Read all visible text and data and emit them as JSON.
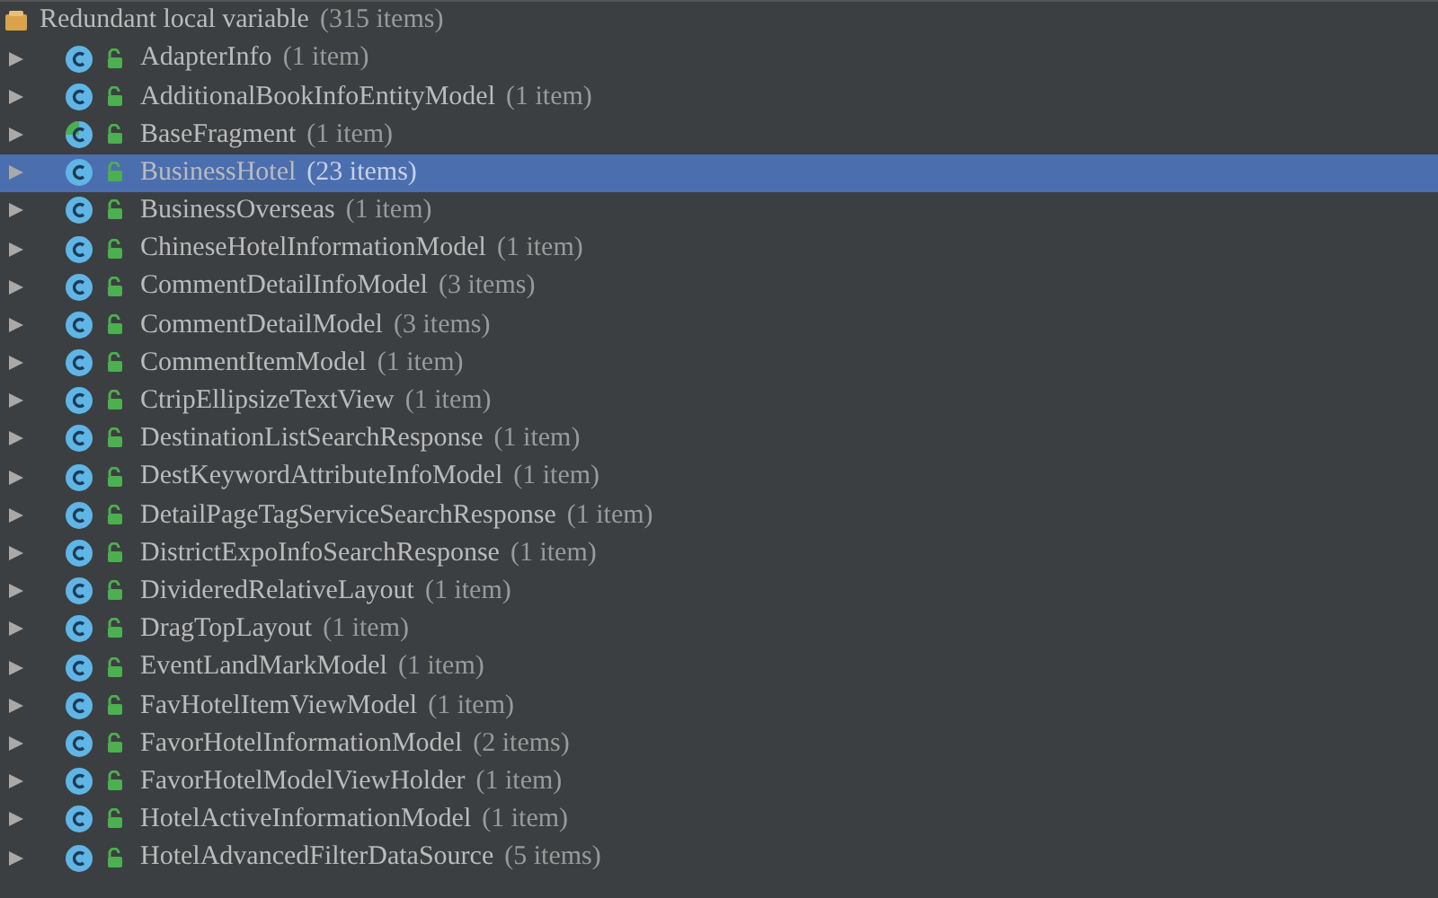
{
  "group": {
    "name": "Redundant local variable",
    "count": "(315 items)"
  },
  "items": [
    {
      "name": "AdapterInfo",
      "count": "(1 item)",
      "kind": "class",
      "selected": false
    },
    {
      "name": "AdditionalBookInfoEntityModel",
      "count": "(1 item)",
      "kind": "class",
      "selected": false
    },
    {
      "name": "BaseFragment",
      "count": "(1 item)",
      "kind": "abstract",
      "selected": false
    },
    {
      "name": "BusinessHotel",
      "count": "(23 items)",
      "kind": "class",
      "selected": true
    },
    {
      "name": "BusinessOverseas",
      "count": "(1 item)",
      "kind": "class",
      "selected": false
    },
    {
      "name": "ChineseHotelInformationModel",
      "count": "(1 item)",
      "kind": "class",
      "selected": false
    },
    {
      "name": "CommentDetailInfoModel",
      "count": "(3 items)",
      "kind": "class",
      "selected": false
    },
    {
      "name": "CommentDetailModel",
      "count": "(3 items)",
      "kind": "class",
      "selected": false
    },
    {
      "name": "CommentItemModel",
      "count": "(1 item)",
      "kind": "class",
      "selected": false
    },
    {
      "name": "CtripEllipsizeTextView",
      "count": "(1 item)",
      "kind": "class",
      "selected": false
    },
    {
      "name": "DestinationListSearchResponse",
      "count": "(1 item)",
      "kind": "class",
      "selected": false
    },
    {
      "name": "DestKeywordAttributeInfoModel",
      "count": "(1 item)",
      "kind": "class",
      "selected": false
    },
    {
      "name": "DetailPageTagServiceSearchResponse",
      "count": "(1 item)",
      "kind": "class",
      "selected": false
    },
    {
      "name": "DistrictExpoInfoSearchResponse",
      "count": "(1 item)",
      "kind": "class",
      "selected": false
    },
    {
      "name": "DivideredRelativeLayout",
      "count": "(1 item)",
      "kind": "class",
      "selected": false
    },
    {
      "name": "DragTopLayout",
      "count": "(1 item)",
      "kind": "class",
      "selected": false
    },
    {
      "name": "EventLandMarkModel",
      "count": "(1 item)",
      "kind": "class",
      "selected": false
    },
    {
      "name": "FavHotelItemViewModel",
      "count": "(1 item)",
      "kind": "class",
      "selected": false
    },
    {
      "name": "FavorHotelInformationModel",
      "count": "(2 items)",
      "kind": "class",
      "selected": false
    },
    {
      "name": "FavorHotelModelViewHolder",
      "count": "(1 item)",
      "kind": "class",
      "selected": false
    },
    {
      "name": "HotelActiveInformationModel",
      "count": "(1 item)",
      "kind": "class",
      "selected": false
    },
    {
      "name": "HotelAdvancedFilterDataSource",
      "count": "(5 items)",
      "kind": "class",
      "selected": false
    }
  ]
}
